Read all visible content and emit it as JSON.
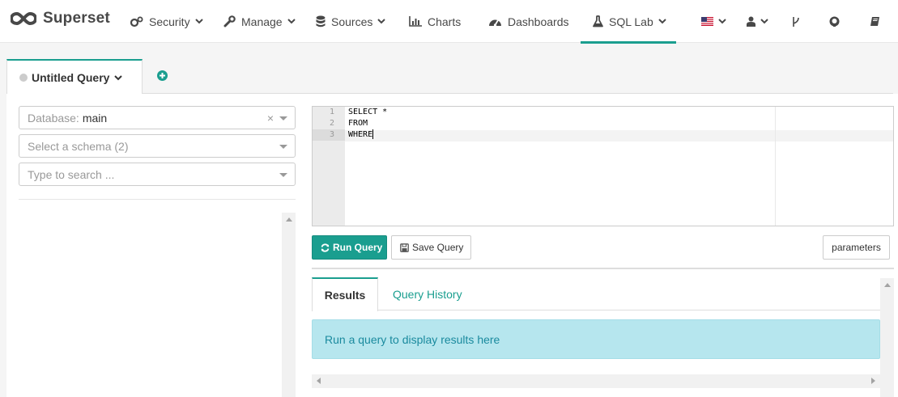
{
  "navbar": {
    "brand": "Superset",
    "items": [
      {
        "label": "Security",
        "icon": "cogs-icon",
        "has_caret": true
      },
      {
        "label": "Manage",
        "icon": "wrench-icon",
        "has_caret": true
      },
      {
        "label": "Sources",
        "icon": "database-icon",
        "has_caret": true
      },
      {
        "label": "Charts",
        "icon": "bar-chart-icon",
        "has_caret": false
      },
      {
        "label": "Dashboards",
        "icon": "dashboard-icon",
        "has_caret": false
      },
      {
        "label": "SQL Lab",
        "icon": "flask-icon",
        "has_caret": true,
        "active": true
      }
    ],
    "right_icons": [
      "us-flag-icon",
      "user-icon",
      "code-branch-icon",
      "github-icon",
      "book-icon"
    ],
    "accent_color": "#1a9e8f"
  },
  "query_tabs": {
    "active_label": "Untitled Query",
    "add_icon": "plus-circle-icon"
  },
  "left": {
    "database": {
      "placeholder": "Database:",
      "value": "main"
    },
    "schema": {
      "placeholder": "Select a schema (2)"
    },
    "table_search": {
      "placeholder": "Type to search ..."
    }
  },
  "editor": {
    "lines": [
      {
        "num": "1",
        "text": "SELECT *"
      },
      {
        "num": "2",
        "text": "FROM"
      },
      {
        "num": "3",
        "text": "WHERE"
      }
    ]
  },
  "toolbar": {
    "run_label": "Run Query",
    "save_label": "Save Query",
    "params_label": "parameters"
  },
  "results": {
    "tabs": [
      "Results",
      "Query History"
    ],
    "empty_message": "Run a query to display results here",
    "alert_color": "#b6e6ee"
  }
}
